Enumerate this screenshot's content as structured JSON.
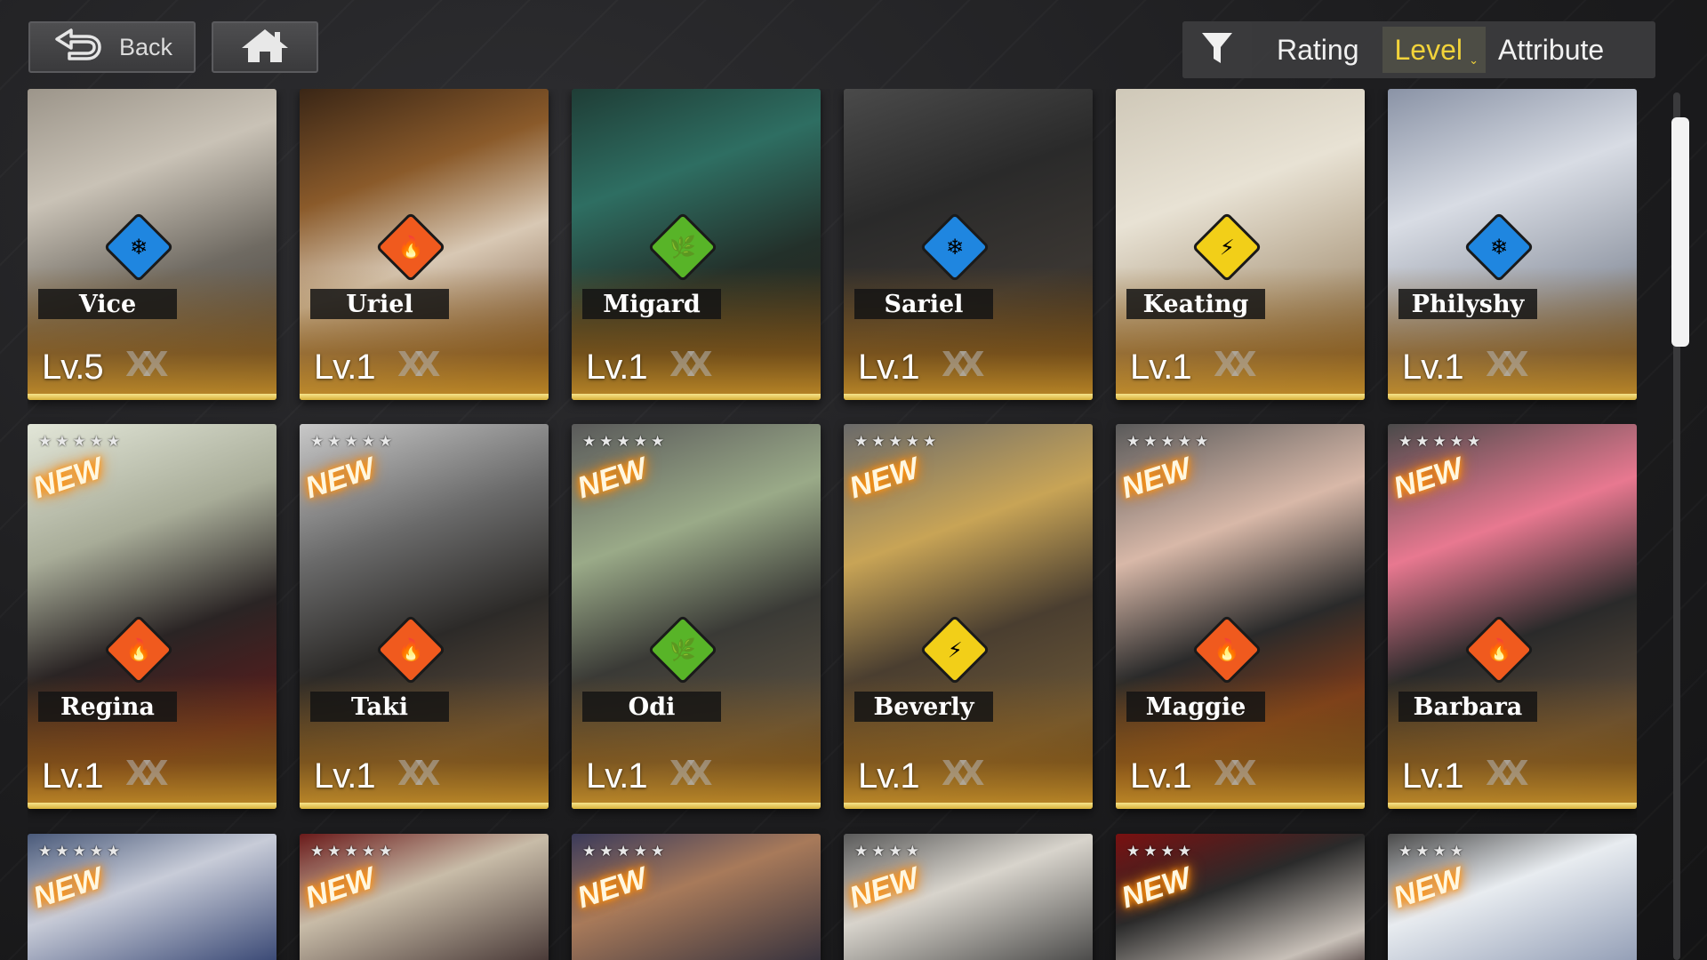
{
  "topbar": {
    "back_label": "Back",
    "home_icon": "home-icon",
    "back_icon": "back-arrow-icon"
  },
  "sort": {
    "filter_icon": "filter-icon",
    "options": [
      "Rating",
      "Level",
      "Attribute"
    ],
    "selected": "Level"
  },
  "colors": {
    "ice": "#1f86e0",
    "fire": "#f05a1e",
    "nature": "#58b428",
    "electric": "#f2cf18",
    "selected_sort": "#f2d33a",
    "card_gold": "#d9b23a"
  },
  "characters": [
    {
      "name": "Vice",
      "level": "Lv.5",
      "attribute": "ice",
      "new": false
    },
    {
      "name": "Uriel",
      "level": "Lv.1",
      "attribute": "fire",
      "new": false
    },
    {
      "name": "Migard",
      "level": "Lv.1",
      "attribute": "nature",
      "new": false
    },
    {
      "name": "Sariel",
      "level": "Lv.1",
      "attribute": "ice",
      "new": false
    },
    {
      "name": "Keating",
      "level": "Lv.1",
      "attribute": "electric",
      "new": false
    },
    {
      "name": "Philyshy",
      "level": "Lv.1",
      "attribute": "ice",
      "new": false
    },
    {
      "name": "Regina",
      "level": "Lv.1",
      "attribute": "fire",
      "new": true,
      "rarity": 5,
      "new_label": "NEW"
    },
    {
      "name": "Taki",
      "level": "Lv.1",
      "attribute": "fire",
      "new": true,
      "rarity": 5,
      "new_label": "NEW"
    },
    {
      "name": "Odi",
      "level": "Lv.1",
      "attribute": "nature",
      "new": true,
      "rarity": 5,
      "new_label": "NEW"
    },
    {
      "name": "Beverly",
      "level": "Lv.1",
      "attribute": "electric",
      "new": true,
      "rarity": 5,
      "new_label": "NEW"
    },
    {
      "name": "Maggie",
      "level": "Lv.1",
      "attribute": "fire",
      "new": true,
      "rarity": 5,
      "new_label": "NEW"
    },
    {
      "name": "Barbara",
      "level": "Lv.1",
      "attribute": "fire",
      "new": true,
      "rarity": 5,
      "new_label": "NEW"
    }
  ],
  "partial_row": [
    {
      "rarity": 5,
      "new_label": "NEW"
    },
    {
      "rarity": 5,
      "new_label": "NEW"
    },
    {
      "rarity": 5,
      "new_label": "NEW"
    },
    {
      "rarity": 4,
      "new_label": "NEW"
    },
    {
      "rarity": 4,
      "new_label": "NEW"
    },
    {
      "rarity": 4,
      "new_label": "NEW"
    }
  ]
}
